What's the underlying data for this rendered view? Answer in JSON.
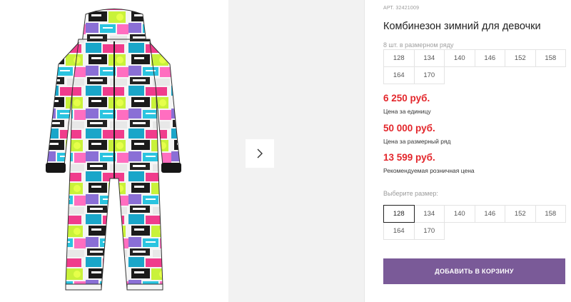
{
  "product": {
    "sku": "АРТ. 32421009",
    "title": "Комбинезон зимний для девочки"
  },
  "gallery": {
    "next_icon": "chevron-right-icon"
  },
  "size_row": {
    "note": "8 шт. в размерном ряду",
    "sizes": [
      "128",
      "134",
      "140",
      "146",
      "152",
      "158",
      "164",
      "170"
    ]
  },
  "prices": [
    {
      "value": "6 250 руб.",
      "label": "Цена за единицу"
    },
    {
      "value": "50 000 руб.",
      "label": "Цена за размерный ряд"
    },
    {
      "value": "13 599 руб.",
      "label": "Рекомендуемая розничная цена"
    }
  ],
  "size_picker": {
    "label": "Выберите размер:",
    "sizes": [
      "128",
      "134",
      "140",
      "146",
      "152",
      "158",
      "164",
      "170"
    ],
    "selected": "128"
  },
  "cart_button": {
    "label": "ДОБАВИТЬ В КОРЗИНУ"
  },
  "colors": {
    "price": "#e3262b",
    "button": "#7a5a98"
  }
}
